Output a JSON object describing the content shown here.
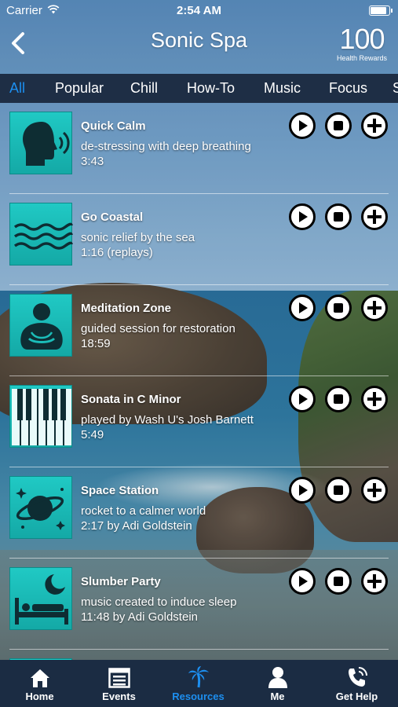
{
  "status_bar": {
    "carrier": "Carrier",
    "time": "2:54 AM",
    "battery_level": 0.95
  },
  "header": {
    "back_icon": "back-chevron-icon",
    "title": "Sonic Spa",
    "rewards_count": "100",
    "rewards_label": "Health Rewards"
  },
  "tabs": [
    {
      "label": "All",
      "active": true
    },
    {
      "label": "Popular",
      "active": false
    },
    {
      "label": "Chill",
      "active": false
    },
    {
      "label": "How-To",
      "active": false
    },
    {
      "label": "Music",
      "active": false
    },
    {
      "label": "Focus",
      "active": false
    },
    {
      "label": "S",
      "active": false
    }
  ],
  "items": [
    {
      "title": "Quick Calm",
      "description": "de-stressing with deep breathing",
      "duration": "3:43",
      "icon": "head-breathing-icon"
    },
    {
      "title": "Go Coastal",
      "description": "sonic relief by the sea",
      "duration": "1:16 (replays)",
      "icon": "waves-icon"
    },
    {
      "title": "Meditation Zone",
      "description": "guided session for restoration",
      "duration": "18:59",
      "icon": "meditating-person-icon"
    },
    {
      "title": "Sonata in C Minor",
      "description": "played by Wash U's Josh Barnett",
      "duration": "5:49",
      "icon": "piano-keys-icon"
    },
    {
      "title": "Space Station",
      "description": "rocket to a calmer world",
      "duration": "2:17 by Adi Goldstein",
      "icon": "planet-icon"
    },
    {
      "title": "Slumber Party",
      "description": "music created to induce sleep",
      "duration": "11:48 by Adi Goldstein",
      "icon": "bed-moon-icon"
    }
  ],
  "controls": {
    "play_icon": "play-icon",
    "stop_icon": "stop-icon",
    "add_icon": "add-icon"
  },
  "tabbar": [
    {
      "label": "Home",
      "icon": "home-icon",
      "active": false
    },
    {
      "label": "Events",
      "icon": "events-icon",
      "active": false
    },
    {
      "label": "Resources",
      "icon": "palm-tree-icon",
      "active": true
    },
    {
      "label": "Me",
      "icon": "person-icon",
      "active": false
    },
    {
      "label": "Get Help",
      "icon": "phone-icon",
      "active": false
    }
  ],
  "colors": {
    "accent": "#1d8ff0",
    "tile": "#1bbdb9",
    "bar": "#1e2e45"
  }
}
